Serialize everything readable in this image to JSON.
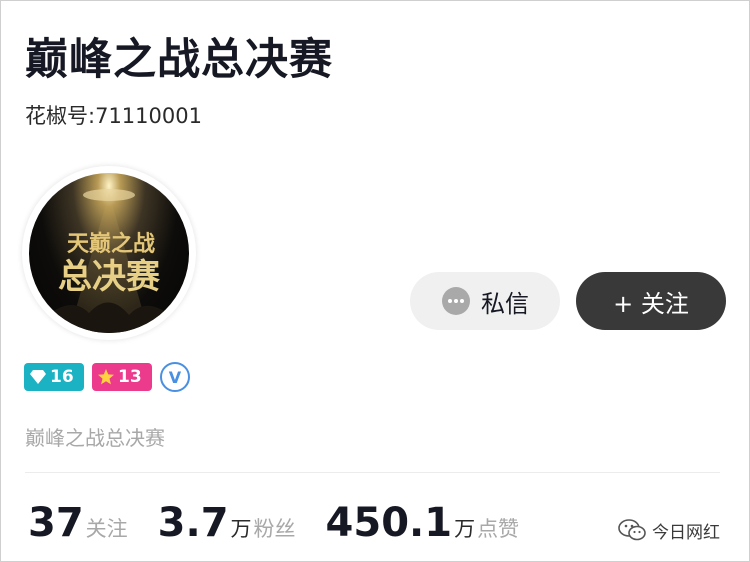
{
  "profile": {
    "title": "巅峰之战总决赛",
    "account_label": "花椒号:",
    "account_id": "71110001",
    "bio": "巅峰之战总决赛",
    "avatar_text_top": "天巅之战",
    "avatar_text_bottom": "总决赛"
  },
  "actions": {
    "message_label": "私信",
    "follow_label": "+ 关注"
  },
  "badges": {
    "diamond_level": "16",
    "star_level": "13",
    "verified_mark": "V"
  },
  "stats": {
    "following_count": "37",
    "following_label": "关注",
    "fans_count": "3.7",
    "fans_unit": "万",
    "fans_label": "粉丝",
    "likes_count": "450.1",
    "likes_unit": "万",
    "likes_label": "点赞"
  },
  "watermark": {
    "text": "今日网红",
    "icon": "wechat-icon"
  },
  "colors": {
    "follow_button_bg": "#393939",
    "message_button_bg": "#f0f0f0",
    "diamond_badge": "#1bb2c3",
    "star_badge": "#ec3a8d",
    "verified": "#4a90e2"
  },
  "icons": [
    "chat-bubble-icon",
    "diamond-icon",
    "star-icon",
    "verified-icon",
    "wechat-icon"
  ]
}
